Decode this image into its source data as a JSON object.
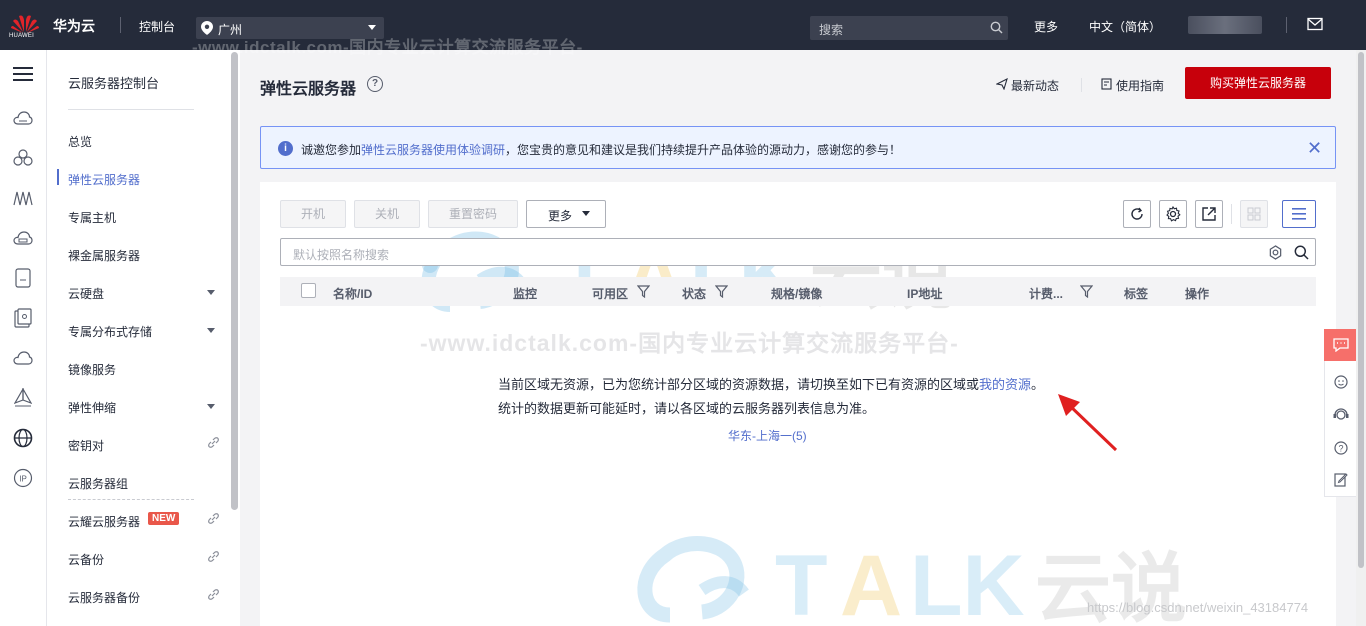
{
  "topbar": {
    "logo_text": "HUAWEI",
    "brand": "华为云",
    "console": "控制台",
    "region": "广州",
    "watermark": "-www.idctalk.com-国内专业云计算交流服务平台-",
    "search_placeholder": "搜索",
    "more": "更多",
    "language": "中文（简体）"
  },
  "rail": {
    "icons": [
      "menu-icon",
      "cloud-server-icon",
      "cloud-cluster-icon",
      "network-icon",
      "storage-icon",
      "database-icon",
      "security-icon",
      "cloud-icon",
      "tag-icon",
      "globe-icon",
      "ip-icon"
    ]
  },
  "nav": {
    "title": "云服务器控制台",
    "items": [
      {
        "label": "总览"
      },
      {
        "label": "弹性云服务器"
      },
      {
        "label": "专属主机"
      },
      {
        "label": "裸金属服务器"
      },
      {
        "label": "云硬盘"
      },
      {
        "label": "专属分布式存储"
      },
      {
        "label": "镜像服务"
      },
      {
        "label": "弹性伸缩"
      },
      {
        "label": "密钥对"
      },
      {
        "label": "云服务器组"
      },
      {
        "label": "云耀云服务器"
      },
      {
        "label": "云备份"
      },
      {
        "label": "云服务器备份"
      }
    ],
    "badge": "NEW"
  },
  "header": {
    "title": "弹性云服务器",
    "latest": "最新动态",
    "guide": "使用指南",
    "buy": "购买弹性云服务器"
  },
  "notice": {
    "prefix": "诚邀您参加",
    "link": "弹性云服务器使用体验调研",
    "suffix": "，您宝贵的意见和建议是我们持续提升产品体验的源动力，感谢您的参与！"
  },
  "toolbar": {
    "power_on": "开机",
    "power_off": "关机",
    "reset_password": "重置密码",
    "more": "更多"
  },
  "search": {
    "placeholder": "默认按照名称搜索"
  },
  "table": {
    "columns": [
      "名称/ID",
      "监控",
      "可用区",
      "状态",
      "规格/镜像",
      "IP地址",
      "计费...",
      "标签",
      "操作"
    ]
  },
  "empty": {
    "line1": "当前区域无资源，已为您统计部分区域的资源数据，请切换至如下已有资源的区域或",
    "line1_link": "我的资源",
    "line1_end": "。",
    "line2": "统计的数据更新可能延时，请以各区域的云服务器列表信息为准。",
    "region_link": "华东-上海一(5)"
  },
  "watermarks": {
    "logo_text": "TALK 云说",
    "line": "-www.idctalk.com-国内专业云计算交流服务平台-",
    "url": "https://blog.csdn.net/weixin_43184774"
  },
  "colors": {
    "topbar": "#252b3a",
    "accent": "#526ecc",
    "buy_button": "#c7000b",
    "notice_bg": "#edf3ff",
    "side_tool": "#f66f6a"
  }
}
